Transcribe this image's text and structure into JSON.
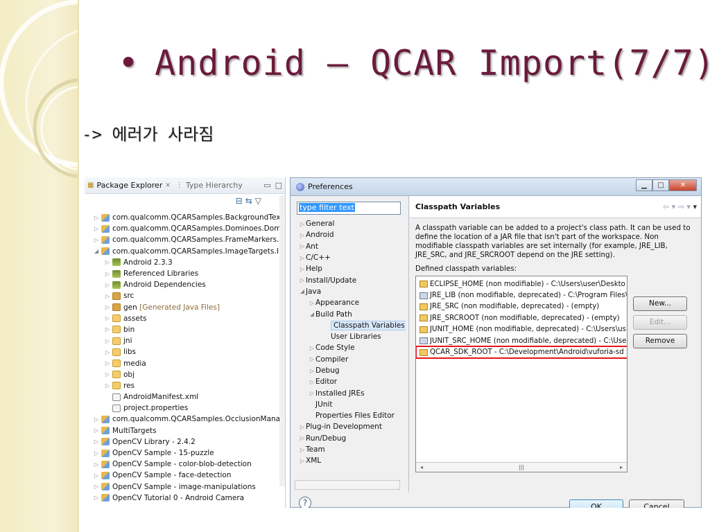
{
  "slide": {
    "title": "Android – QCAR Import(7/7)",
    "bullet": "•",
    "subtitle": "-> 에러가 사라짐"
  },
  "package_explorer": {
    "tab_active": "Package Explorer",
    "tab_inactive": "Type Hierarchy",
    "items": [
      "com.qualcomm.QCARSamples.BackgroundTextu",
      "com.qualcomm.QCARSamples.Dominoes.Domir",
      "com.qualcomm.QCARSamples.FrameMarkers.Fra",
      "com.qualcomm.QCARSamples.ImageTargets.Ima",
      "Android 2.3.3",
      "Referenced Libraries",
      "Android Dependencies",
      "src",
      "gen",
      "assets",
      "bin",
      "jni",
      "libs",
      "media",
      "obj",
      "res",
      "AndroidManifest.xml",
      "project.properties",
      "com.qualcomm.QCARSamples.OcclusionManage",
      "MultiTargets",
      "OpenCV Library - 2.4.2",
      "OpenCV Sample - 15-puzzle",
      "OpenCV Sample - color-blob-detection",
      "OpenCV Sample - face-detection",
      "OpenCV Sample - image-manipulations",
      "OpenCV Tutorial 0 - Android Camera"
    ],
    "gen_suffix": "[Generated Java Files]"
  },
  "preferences": {
    "window_title": "Preferences",
    "filter_placeholder": "type filter text",
    "tree": {
      "general": "General",
      "android": "Android",
      "ant": "Ant",
      "cpp": "C/C++",
      "help": "Help",
      "install": "Install/Update",
      "java": "Java",
      "appearance": "Appearance",
      "build_path": "Build Path",
      "classpath_variables": "Classpath Variables",
      "user_libraries": "User Libraries",
      "code_style": "Code Style",
      "compiler": "Compiler",
      "debug": "Debug",
      "editor": "Editor",
      "installed_jres": "Installed JREs",
      "junit": "JUnit",
      "properties_editor": "Properties Files Editor",
      "plugin_dev": "Plug-in Development",
      "run_debug": "Run/Debug",
      "team": "Team",
      "xml": "XML"
    },
    "page_title": "Classpath Variables",
    "description": "A classpath variable can be added to a project's class path. It can be used to define the location of a JAR file that isn't part of the workspace. Non modifiable classpath variables are set internally (for example, JRE_LIB, JRE_SRC, and JRE_SRCROOT depend on the JRE setting).",
    "defined_label": "Defined classpath variables:",
    "variables": [
      "ECLIPSE_HOME (non modifiable) - C:\\Users\\user\\Deskto",
      "JRE_LIB (non modifiable, deprecated) - C:\\Program Files\\",
      "JRE_SRC (non modifiable, deprecated) - (empty)",
      "JRE_SRCROOT (non modifiable, deprecated) - (empty)",
      "JUNIT_HOME (non modifiable, deprecated) - C:\\Users\\us",
      "JUNIT_SRC_HOME (non modifiable, deprecated) - C:\\User",
      "QCAR_SDK_ROOT - C:\\Development\\Android\\vuforia-sd"
    ],
    "buttons": {
      "new": "New...",
      "edit": "Edit...",
      "remove": "Remove",
      "ok": "OK",
      "cancel": "Cancel"
    },
    "highlight_color": "#e5141b",
    "help_glyph": "?"
  }
}
